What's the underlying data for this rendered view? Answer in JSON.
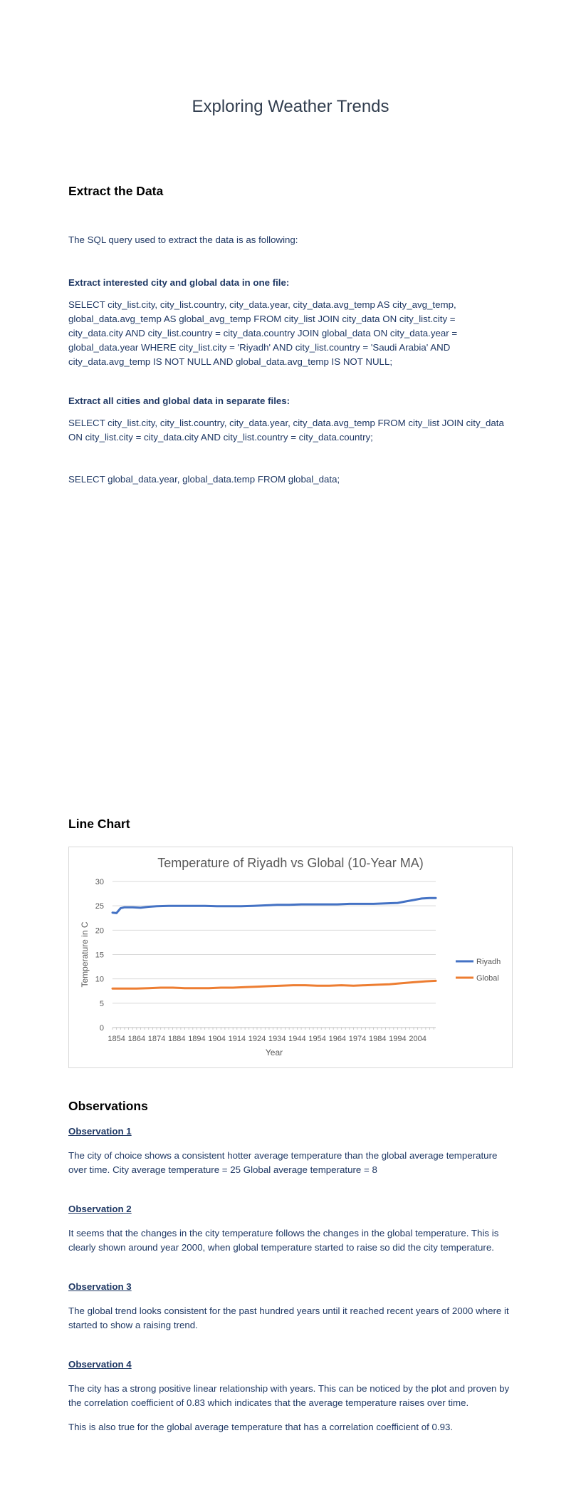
{
  "doc": {
    "title": "Exploring Weather Trends",
    "extract": {
      "heading": "Extract the Data",
      "intro": "The SQL query used to extract the data is as following:",
      "sub1": "Extract interested city and global data in one file:",
      "query1": "SELECT city_list.city, city_list.country, city_data.year, city_data.avg_temp AS city_avg_temp, global_data.avg_temp AS global_avg_temp FROM city_list JOIN city_data ON city_list.city = city_data.city AND city_list.country = city_data.country JOIN global_data ON city_data.year = global_data.year WHERE city_list.city = 'Riyadh' AND city_list.country = 'Saudi Arabia' AND city_data.avg_temp IS NOT NULL AND global_data.avg_temp IS NOT NULL;",
      "sub2": "Extract all cities and global data in separate files:",
      "query2": "SELECT city_list.city, city_list.country, city_data.year, city_data.avg_temp FROM city_list JOIN city_data ON city_list.city = city_data.city AND city_list.country = city_data.country;",
      "query3": "SELECT global_data.year, global_data.temp FROM global_data;"
    },
    "line_chart_heading": "Line Chart",
    "observations": {
      "heading": "Observations",
      "items": [
        {
          "title": "Observation 1",
          "text": "The city of choice shows a consistent hotter average temperature than the global average temperature over time.  City average temperature = 25 Global average temperature = 8"
        },
        {
          "title": "Observation 2",
          "text": "It seems that the changes in the city temperature follows the changes in the global temperature. This is clearly shown around year 2000, when global temperature started to raise so did the city temperature."
        },
        {
          "title": "Observation 3",
          "text": "The global trend looks consistent for the past hundred years until it reached recent years of 2000 where it started to show a raising trend."
        },
        {
          "title": "Observation 4",
          "text": "The city has a strong positive linear relationship with years. This can be noticed by the plot and proven by the correlation coefficient of 0.83 which indicates that the average temperature raises over time."
        }
      ],
      "extra": "This is also true for the global average temperature that has a correlation coefficient of 0.93."
    }
  },
  "chart_data": {
    "type": "line",
    "title": "Temperature of Riyadh vs Global (10-Year MA)",
    "xlabel": "Year",
    "ylabel": "Temperature in C",
    "ylim": [
      0,
      30
    ],
    "yticks": [
      0,
      5,
      10,
      15,
      20,
      25,
      30
    ],
    "xlim": [
      1852,
      2013
    ],
    "xticks": [
      1854,
      1864,
      1874,
      1884,
      1894,
      1904,
      1914,
      1924,
      1934,
      1944,
      1954,
      1964,
      1974,
      1984,
      1994,
      2004
    ],
    "grid": true,
    "legend_position": "right",
    "series": [
      {
        "name": "Riyadh",
        "color": "#4472c4",
        "x": [
          1852,
          1854,
          1856,
          1858,
          1862,
          1866,
          1870,
          1874,
          1880,
          1886,
          1892,
          1898,
          1904,
          1910,
          1916,
          1922,
          1928,
          1934,
          1940,
          1946,
          1952,
          1958,
          1964,
          1970,
          1976,
          1982,
          1988,
          1994,
          1998,
          2002,
          2006,
          2010,
          2013
        ],
        "values": [
          23.6,
          23.5,
          24.5,
          24.7,
          24.7,
          24.6,
          24.8,
          24.9,
          25.0,
          25.0,
          25.0,
          25.0,
          24.9,
          24.9,
          24.9,
          25.0,
          25.1,
          25.2,
          25.2,
          25.3,
          25.3,
          25.3,
          25.3,
          25.4,
          25.4,
          25.4,
          25.5,
          25.6,
          25.9,
          26.2,
          26.5,
          26.6,
          26.6
        ]
      },
      {
        "name": "Global",
        "color": "#ed7d31",
        "x": [
          1852,
          1858,
          1864,
          1870,
          1876,
          1882,
          1888,
          1894,
          1900,
          1906,
          1912,
          1918,
          1924,
          1930,
          1936,
          1942,
          1948,
          1954,
          1960,
          1966,
          1972,
          1978,
          1984,
          1990,
          1996,
          2002,
          2008,
          2013
        ],
        "values": [
          8.0,
          8.0,
          8.0,
          8.1,
          8.2,
          8.2,
          8.1,
          8.1,
          8.1,
          8.2,
          8.2,
          8.3,
          8.4,
          8.5,
          8.6,
          8.7,
          8.7,
          8.6,
          8.6,
          8.7,
          8.6,
          8.7,
          8.8,
          8.9,
          9.1,
          9.3,
          9.5,
          9.6
        ]
      }
    ]
  }
}
